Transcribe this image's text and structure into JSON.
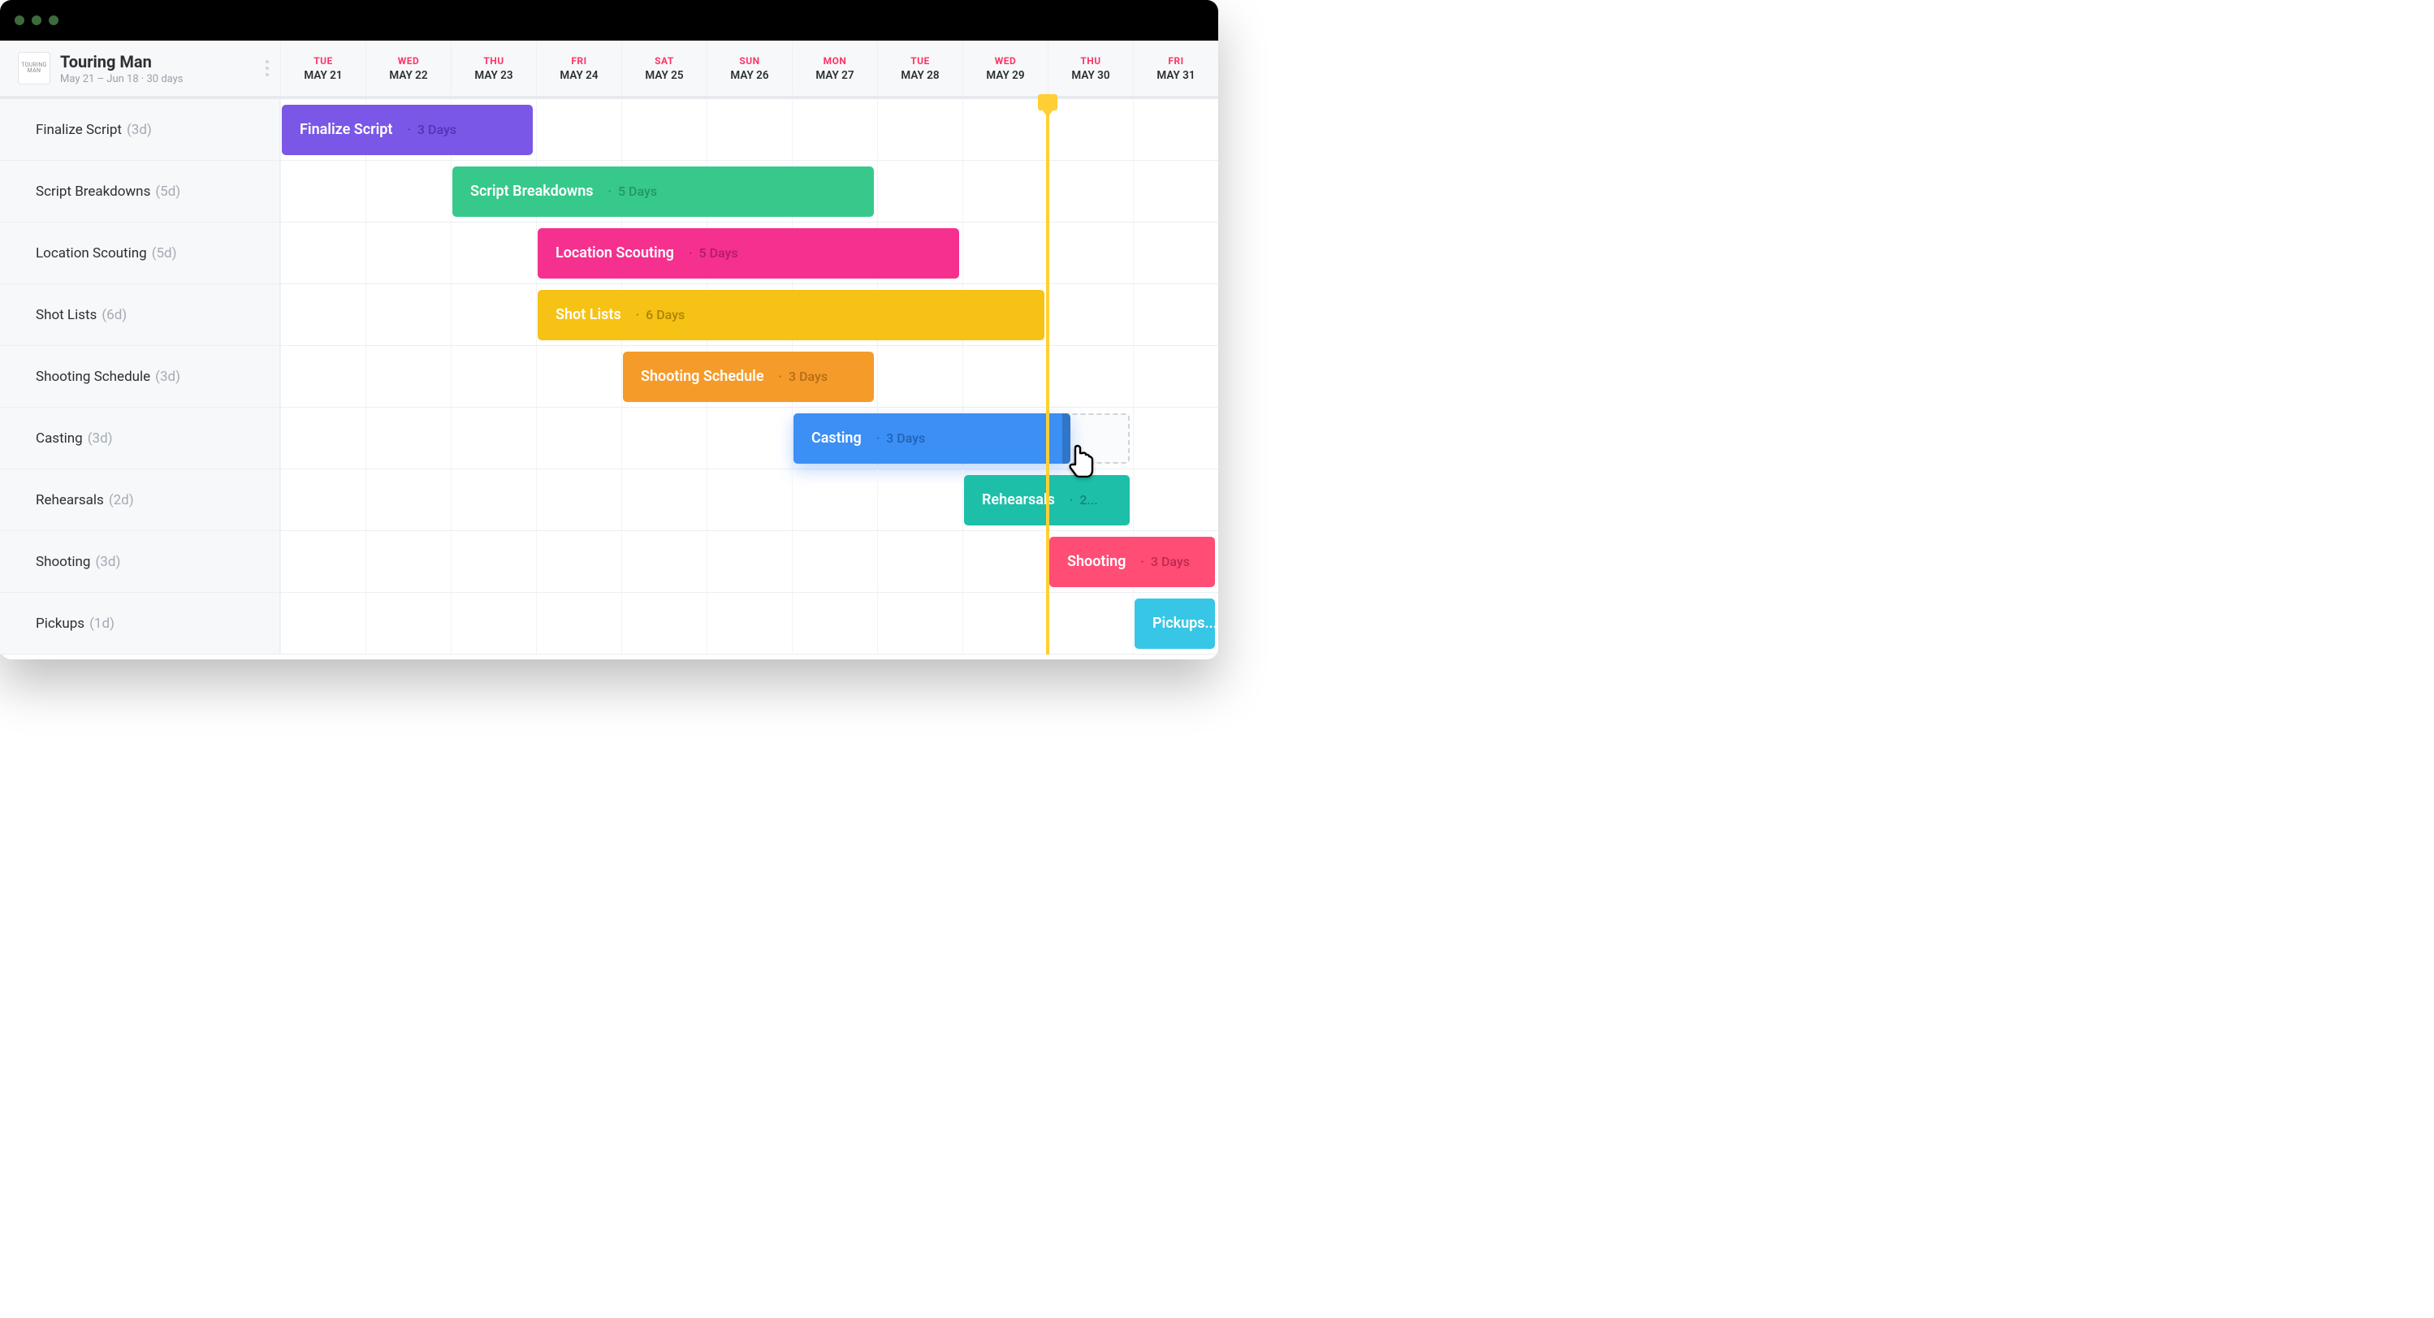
{
  "project": {
    "thumb_line1": "TOURING",
    "thumb_line2": "MAN",
    "title": "Touring Man",
    "subtitle": "May 21 – Jun 18  ·  30 days"
  },
  "columns": [
    {
      "dow": "TUE",
      "label": "MAY 21"
    },
    {
      "dow": "WED",
      "label": "MAY 22"
    },
    {
      "dow": "THU",
      "label": "MAY 23"
    },
    {
      "dow": "FRI",
      "label": "MAY 24"
    },
    {
      "dow": "SAT",
      "label": "MAY 25"
    },
    {
      "dow": "SUN",
      "label": "MAY 26"
    },
    {
      "dow": "MON",
      "label": "MAY 27"
    },
    {
      "dow": "TUE",
      "label": "MAY 28"
    },
    {
      "dow": "WED",
      "label": "MAY 29"
    },
    {
      "dow": "THU",
      "label": "MAY 30"
    },
    {
      "dow": "FRI",
      "label": "MAY 31"
    }
  ],
  "today_column_index": 9,
  "tasks": [
    {
      "name": "Finalize Script",
      "dur_label": "(3d)",
      "bar_label": "Finalize Script",
      "bar_dur": "3 Days",
      "start": 0,
      "span": 3,
      "color": "#7a57e6",
      "dur_color": "#4a2fb0"
    },
    {
      "name": "Script Breakdowns",
      "dur_label": "(5d)",
      "bar_label": "Script Breakdowns",
      "bar_dur": "5 Days",
      "start": 2,
      "span": 5,
      "color": "#37c98b",
      "dur_color": "#1e8f5f"
    },
    {
      "name": "Location Scouting",
      "dur_label": "(5d)",
      "bar_label": "Location Scouting",
      "bar_dur": "5 Days",
      "start": 3,
      "span": 5,
      "color": "#f5308f",
      "dur_color": "#a51a5d"
    },
    {
      "name": "Shot Lists",
      "dur_label": "(6d)",
      "bar_label": "Shot Lists",
      "bar_dur": "6 Days",
      "start": 3,
      "span": 6,
      "color": "#f6c215",
      "dur_color": "#a07a00"
    },
    {
      "name": "Shooting Schedule",
      "dur_label": "(3d)",
      "bar_label": "Shooting Schedule",
      "bar_dur": "3 Days",
      "start": 4,
      "span": 3,
      "color": "#f59b2a",
      "dur_color": "#aa6512"
    },
    {
      "name": "Casting",
      "dur_label": "(3d)",
      "bar_label": "Casting",
      "bar_dur": "3 Days",
      "start": 6,
      "span": 3.3,
      "color": "#3b8ff5",
      "dur_color": "#1f5aa8",
      "ghost_start": 6,
      "ghost_span": 4,
      "is_dragging": true
    },
    {
      "name": "Rehearsals",
      "dur_label": "(2d)",
      "bar_label": "Rehearsals",
      "bar_dur": "2...",
      "start": 8,
      "span": 2,
      "color": "#1dbfa9",
      "dur_color": "#0f7d6e"
    },
    {
      "name": "Shooting",
      "dur_label": "(3d)",
      "bar_label": "Shooting",
      "bar_dur": "3 Days",
      "start": 9,
      "span": 2,
      "color": "#ff4d75",
      "dur_color": "#b22448"
    },
    {
      "name": "Pickups",
      "dur_label": "(1d)",
      "bar_label": "Pickups...",
      "bar_dur": "",
      "start": 10,
      "span": 1,
      "color": "#38c6e6",
      "dur_color": "#1a7f96"
    }
  ],
  "chart_data": {
    "type": "gantt",
    "title": "Touring Man",
    "date_range": "May 21 – Jun 18",
    "duration_days": 30,
    "visible_dates": [
      "May 21",
      "May 22",
      "May 23",
      "May 24",
      "May 25",
      "May 26",
      "May 27",
      "May 28",
      "May 29",
      "May 30",
      "May 31"
    ],
    "today": "May 30",
    "tasks": [
      {
        "name": "Finalize Script",
        "duration_days": 3,
        "start": "May 21",
        "end": "May 23",
        "color": "#7a57e6"
      },
      {
        "name": "Script Breakdowns",
        "duration_days": 5,
        "start": "May 23",
        "end": "May 27",
        "color": "#37c98b"
      },
      {
        "name": "Location Scouting",
        "duration_days": 5,
        "start": "May 24",
        "end": "May 28",
        "color": "#f5308f"
      },
      {
        "name": "Shot Lists",
        "duration_days": 6,
        "start": "May 24",
        "end": "May 29",
        "color": "#f6c215"
      },
      {
        "name": "Shooting Schedule",
        "duration_days": 3,
        "start": "May 25",
        "end": "May 27",
        "color": "#f59b2a"
      },
      {
        "name": "Casting",
        "duration_days": 3,
        "start": "May 27",
        "end": "May 29",
        "color": "#3b8ff5",
        "being_dragged": true,
        "drop_target_end": "May 30"
      },
      {
        "name": "Rehearsals",
        "duration_days": 2,
        "start": "May 29",
        "end": "May 30",
        "color": "#1dbfa9"
      },
      {
        "name": "Shooting",
        "duration_days": 3,
        "start": "May 30",
        "end": "Jun 1",
        "color": "#ff4d75"
      },
      {
        "name": "Pickups",
        "duration_days": 1,
        "start": "May 31",
        "end": "May 31",
        "color": "#38c6e6"
      }
    ]
  }
}
